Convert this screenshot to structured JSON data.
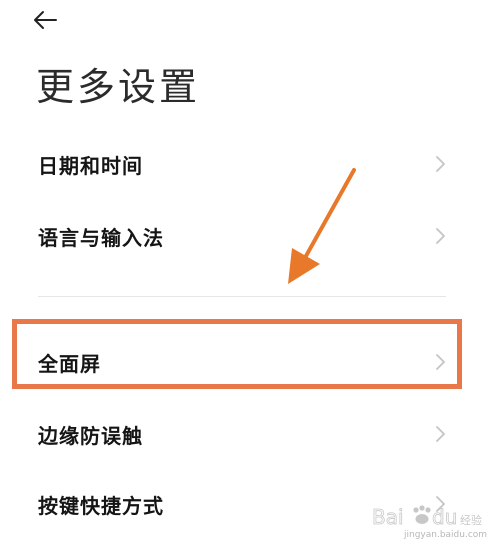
{
  "header": {
    "back_icon": "arrow-left-icon",
    "title": "更多设置"
  },
  "settings": {
    "items": [
      {
        "label": "日期和时间",
        "icon": "chevron-right-icon"
      },
      {
        "label": "语言与输入法",
        "icon": "chevron-right-icon"
      },
      {
        "label": "全面屏",
        "icon": "chevron-right-icon",
        "highlighted": true
      },
      {
        "label": "边缘防误触",
        "icon": "chevron-right-icon"
      },
      {
        "label": "按键快捷方式",
        "icon": "chevron-right-icon"
      }
    ]
  },
  "annotation": {
    "arrow_color": "#e8782a",
    "box_color": "#e8784a"
  },
  "watermark": {
    "brand": "Bai du 经验",
    "url": "jingyan.baidu.com"
  },
  "colors": {
    "background": "#ffffff",
    "text_primary": "#151515",
    "chevron": "#c4c4c4",
    "divider": "#e6e6e6"
  }
}
